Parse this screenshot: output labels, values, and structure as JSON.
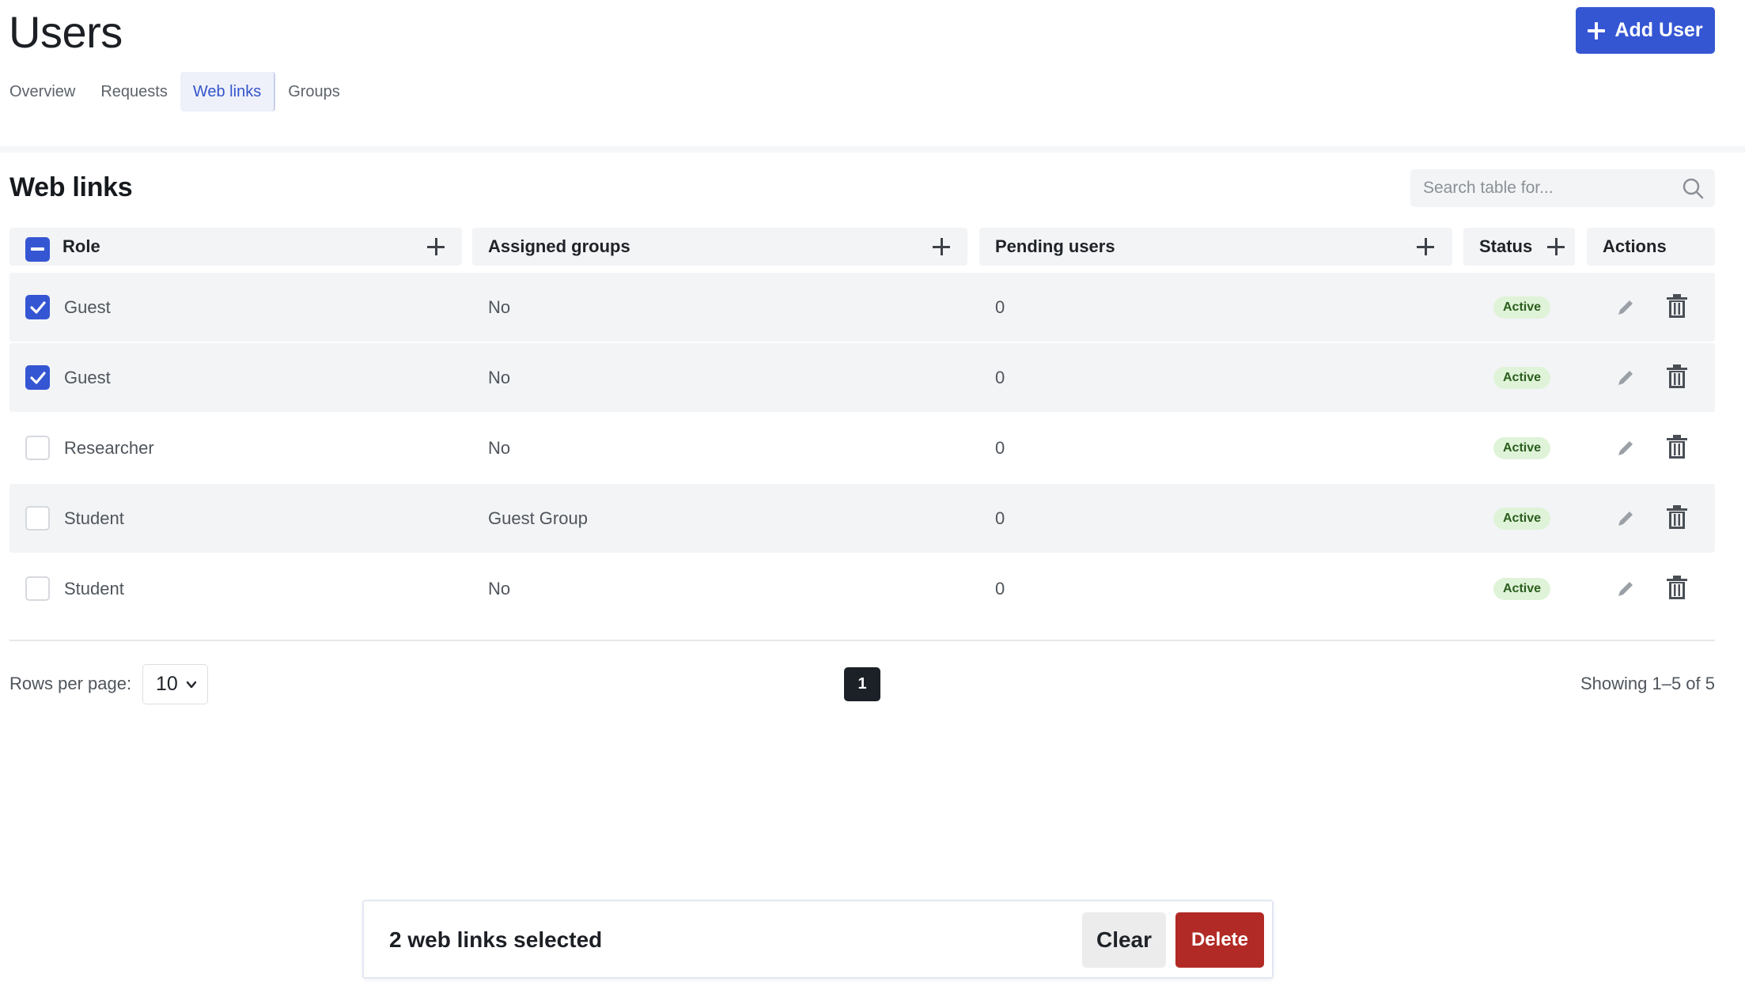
{
  "header": {
    "title": "Users",
    "add_button_label": "Add User"
  },
  "tabs": [
    {
      "label": "Overview",
      "active": false
    },
    {
      "label": "Requests",
      "active": false
    },
    {
      "label": "Web links",
      "active": true
    },
    {
      "label": "Groups",
      "active": false
    }
  ],
  "section": {
    "title": "Web links",
    "search_placeholder": "Search table for..."
  },
  "table": {
    "columns": [
      "Role",
      "Assigned groups",
      "Pending users",
      "Status",
      "Actions"
    ],
    "rows": [
      {
        "role": "Guest",
        "assigned_groups": "No",
        "pending_users": "0",
        "status": "Active",
        "checked": true
      },
      {
        "role": "Guest",
        "assigned_groups": "No",
        "pending_users": "0",
        "status": "Active",
        "checked": true
      },
      {
        "role": "Researcher",
        "assigned_groups": "No",
        "pending_users": "0",
        "status": "Active",
        "checked": false
      },
      {
        "role": "Student",
        "assigned_groups": "Guest Group",
        "pending_users": "0",
        "status": "Active",
        "checked": false
      },
      {
        "role": "Student",
        "assigned_groups": "No",
        "pending_users": "0",
        "status": "Active",
        "checked": false
      }
    ]
  },
  "pagination": {
    "rows_per_page_label": "Rows per page:",
    "rows_per_page_value": "10",
    "current_page": "1",
    "showing_text": "Showing 1–5 of 5"
  },
  "selection_bar": {
    "text": "2 web links selected",
    "clear_label": "Clear",
    "delete_label": "Delete"
  },
  "colors": {
    "primary": "#3556d3",
    "danger": "#b22a25",
    "active_badge_bg": "#dff3d8",
    "active_badge_text": "#2a5d1d"
  },
  "icons": [
    "plus-icon",
    "search-icon",
    "checkbox-checked-icon",
    "checkbox-indeterminate-icon",
    "pencil-icon",
    "trash-icon",
    "chevron-down-icon"
  ]
}
